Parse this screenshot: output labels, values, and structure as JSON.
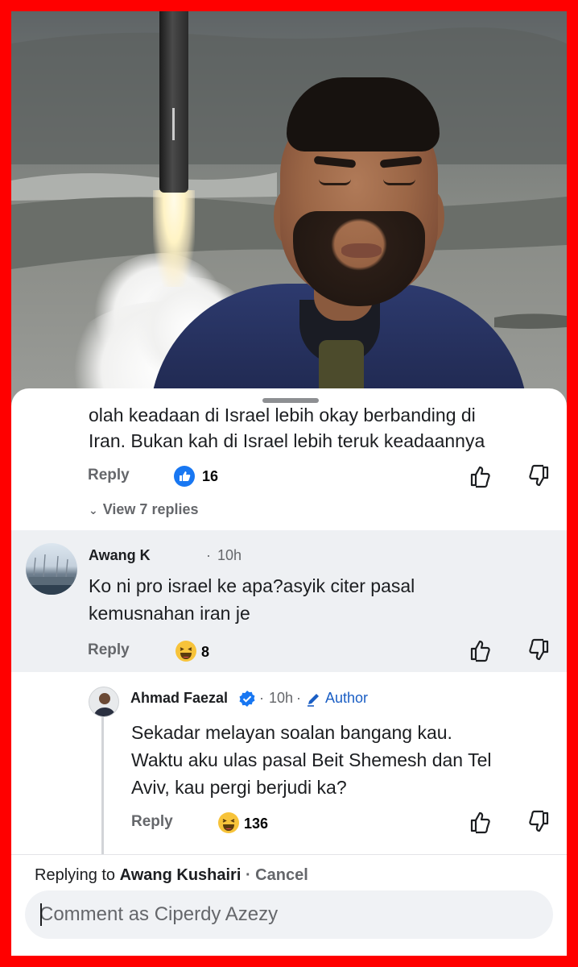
{
  "header_image": {
    "description_icon": "video-thumbnail"
  },
  "top_comment": {
    "text_line1": "olah keadaan di Israel lebih okay berbanding di",
    "text_line2": "Iran. Bukan kah di Israel lebih teruk keadaannya",
    "reply_label": "Reply",
    "reaction_icon": "like-icon",
    "reaction_count": "16",
    "view_replies": "View 7 replies"
  },
  "comment_awang": {
    "name": "Awang K",
    "time": "10h",
    "separator": "·",
    "text_line1": "Ko ni pro israel ke apa?asyik citer pasal",
    "text_line2": "kemusnahan iran je",
    "reply_label": "Reply",
    "reaction_icon": "haha-icon",
    "reaction_count": "8"
  },
  "reply_ahmad": {
    "name": "Ahmad Faezal",
    "time": "10h",
    "separator": "·",
    "author_label": "Author",
    "text_line1": "Sekadar melayan soalan bangang kau.",
    "text_line2": "Waktu aku ulas pasal Beit Shemesh dan Tel",
    "text_line3": "Aviv, kau pergi berjudi ka?",
    "reply_label": "Reply",
    "reaction_icon": "haha-icon",
    "reaction_count": "136"
  },
  "composer": {
    "replying_prefix": "Replying to",
    "replying_name": "Awang Kushairi",
    "cancel": "· Cancel",
    "placeholder": "Comment as Ciperdy Azezy"
  },
  "colors": {
    "frame": "#ff0000",
    "like_blue": "#1877f2",
    "author_blue": "#1a5ec4",
    "muted": "#65676b",
    "band": "#eef0f3"
  }
}
